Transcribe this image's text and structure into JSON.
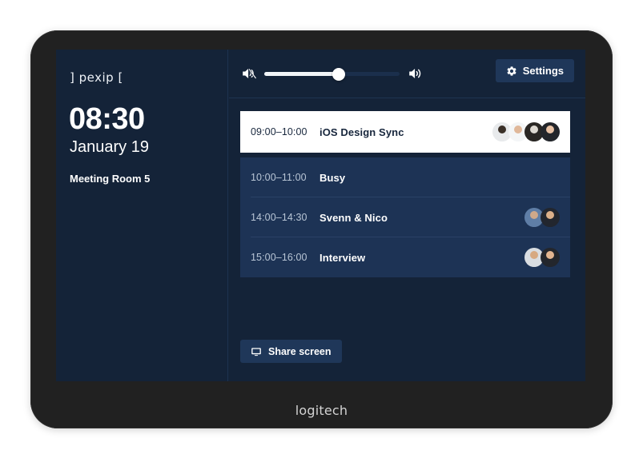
{
  "device": {
    "brand": "logitech",
    "frame_color": "#212121"
  },
  "screen": {
    "background_color": "#142338",
    "panel_color": "#1d3355",
    "accent_button_color": "#1f3759"
  },
  "sidebar": {
    "logo_text": "] pexip [",
    "clock_time": "08:30",
    "clock_date": "January 19",
    "room_name": "Meeting Room 5"
  },
  "toolbar": {
    "mute_icon": "speaker-mute-icon",
    "volume_up_icon": "speaker-volume-up-icon",
    "volume_level_percent": 55,
    "settings_label": "Settings",
    "settings_icon": "gear-icon"
  },
  "meetings": [
    {
      "time": "09:00–10:00",
      "title": "iOS Design Sync",
      "active": true,
      "participants": [
        {
          "head": "#3a3028",
          "body": "#e8eaec"
        },
        {
          "head": "#e0b89a",
          "body": "#f4f6f7"
        },
        {
          "head": "#ded9d2",
          "body": "#2a2724"
        },
        {
          "head": "#e9c3a6",
          "body": "#23262b"
        }
      ]
    },
    {
      "time": "10:00–11:00",
      "title": "Busy",
      "active": false,
      "participants": []
    },
    {
      "time": "14:00–14:30",
      "title": "Svenn & Nico",
      "active": false,
      "participants": [
        {
          "head": "#cfa98a",
          "body": "#5f7ea6"
        },
        {
          "head": "#dcb089",
          "body": "#22262e"
        }
      ]
    },
    {
      "time": "15:00–16:00",
      "title": "Interview",
      "active": false,
      "participants": [
        {
          "head": "#d7a981",
          "body": "#d9dde1"
        },
        {
          "head": "#e2b590",
          "body": "#23262c"
        }
      ]
    }
  ],
  "footer": {
    "share_screen_label": "Share screen",
    "share_screen_icon": "monitor-icon"
  }
}
